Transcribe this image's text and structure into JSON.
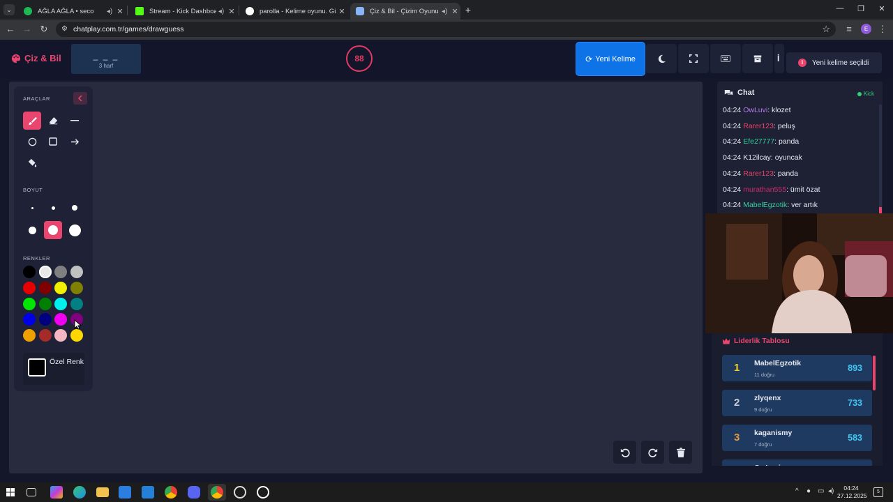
{
  "browser": {
    "tabs": [
      {
        "title": "AĞLA AĞLA • seco",
        "favicon_color": "#1db954",
        "active": false
      },
      {
        "title": "Stream - Kick Dashboard",
        "favicon_color": "#53fc18",
        "active": false
      },
      {
        "title": "parolla - Kelime oyunu. Günlük",
        "favicon_color": "#ffffff",
        "active": false
      },
      {
        "title": "Çiz & Bil - Çizim Oyunu",
        "favicon_color": "#8ab4f8",
        "active": true
      }
    ],
    "url": "chatplay.com.tr/games/drawguess",
    "profile_initial": "E"
  },
  "header": {
    "logo": "Çiz & Bil",
    "word_blanks": "_ _ _",
    "word_length": "3 harf",
    "timer": "88",
    "new_word_label": "Yeni Kelime",
    "toast": "Yeni kelime seçildi",
    "toast_icon": "i",
    "partial_button_char": "İ"
  },
  "tools": {
    "section_tools": "ARAÇLAR",
    "section_size": "BOYUT",
    "section_colors": "RENKLER",
    "custom_color_label": "Özel Renk",
    "selected_tool": "brush",
    "selected_size_index": 4,
    "palette": [
      [
        "#000000",
        "#e8e8e8",
        "#808080",
        "#c0c0c0"
      ],
      [
        "#e60000",
        "#800000",
        "#f0f000",
        "#808000"
      ],
      [
        "#00e600",
        "#008000",
        "#00f0f0",
        "#008080"
      ],
      [
        "#0000e6",
        "#000080",
        "#f000f0",
        "#800080"
      ],
      [
        "#f0a000",
        "#a52a2a",
        "#f4b6c2",
        "#ffd700"
      ]
    ]
  },
  "chat": {
    "title": "Chat",
    "platform": "Kick",
    "messages": [
      {
        "time": "04:24",
        "user": "OwLuvi",
        "color": "#b87cf0",
        "text": "klozet"
      },
      {
        "time": "04:24",
        "user": "Rarer123",
        "color": "#e9456e",
        "text": "peluş"
      },
      {
        "time": "04:24",
        "user": "Efe27777",
        "color": "#36d0a0",
        "text": "panda"
      },
      {
        "time": "04:24",
        "user": "K12ilcay",
        "color": "#e7e9f3",
        "text": "oyuncak"
      },
      {
        "time": "04:24",
        "user": "Rarer123",
        "color": "#e9456e",
        "text": "panda"
      },
      {
        "time": "04:24",
        "user": "murathan555",
        "color": "#d02a6a",
        "text": "ümit özat"
      },
      {
        "time": "04:24",
        "user": "MabelEgzotik",
        "color": "#36d0a0",
        "text": "ver artık"
      }
    ]
  },
  "leaderboard": {
    "title": "Liderlik Tablosu",
    "rows": [
      {
        "rank": "1",
        "name": "MabelEgzotik",
        "sub": "11 doğru",
        "points": "893",
        "rank_color": "#f5d020"
      },
      {
        "rank": "2",
        "name": "zlyqenx",
        "sub": "9 doğru",
        "points": "733",
        "rank_color": "#c8cdd8"
      },
      {
        "rank": "3",
        "name": "kaganismy",
        "sub": "7 doğru",
        "points": "583",
        "rank_color": "#e39b3a"
      },
      {
        "rank": "",
        "name": "OwLuvi",
        "sub": "",
        "points": "",
        "rank_color": "#e7e9f3"
      }
    ]
  },
  "taskbar": {
    "time": "04:24",
    "date": "27.12.2025",
    "notifications": "5"
  }
}
